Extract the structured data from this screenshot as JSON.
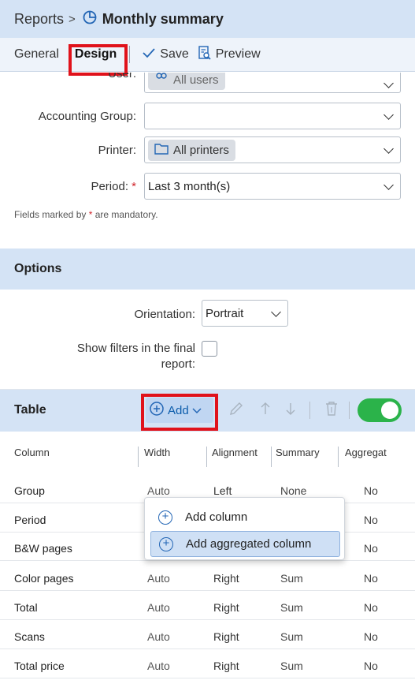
{
  "breadcrumb": {
    "parent": "Reports",
    "separator": ">",
    "title": "Monthly summary"
  },
  "tabs": {
    "general": "General",
    "design": "Design"
  },
  "toolbar": {
    "save": "Save",
    "preview": "Preview"
  },
  "filters": {
    "user_label": "User:",
    "user_value": "All users",
    "accounting_group_label": "Accounting Group:",
    "accounting_group_value": "",
    "printer_label": "Printer:",
    "printer_value": "All printers",
    "period_label": "Period:",
    "period_required": "*",
    "period_value": "Last 3 month(s)",
    "mandatory_note_prefix": "Fields marked by",
    "mandatory_note_star": "*",
    "mandatory_note_suffix": "are mandatory."
  },
  "options": {
    "header": "Options",
    "orientation_label": "Orientation:",
    "orientation_value": "Portrait",
    "show_filters_label_line1": "Show filters in the final",
    "show_filters_label_line2": "report:",
    "show_filters_checked": false
  },
  "table": {
    "header": "Table",
    "add_label": "Add",
    "toggle_on": true,
    "columns": [
      "Column",
      "Width",
      "Alignment",
      "Summary",
      "Aggregat"
    ],
    "rows": [
      {
        "column": "Group",
        "width": "Auto",
        "alignment": "Left",
        "summary": "None",
        "aggregated": "No"
      },
      {
        "column": "Period",
        "width": "",
        "alignment": "",
        "summary": "",
        "aggregated": "No"
      },
      {
        "column": "B&W pages",
        "width": "",
        "alignment": "",
        "summary": "",
        "aggregated": "No"
      },
      {
        "column": "Color pages",
        "width": "Auto",
        "alignment": "Right",
        "summary": "Sum",
        "aggregated": "No"
      },
      {
        "column": "Total",
        "width": "Auto",
        "alignment": "Right",
        "summary": "Sum",
        "aggregated": "No"
      },
      {
        "column": "Scans",
        "width": "Auto",
        "alignment": "Right",
        "summary": "Sum",
        "aggregated": "No"
      },
      {
        "column": "Total price",
        "width": "Auto",
        "alignment": "Right",
        "summary": "Sum",
        "aggregated": "No"
      }
    ]
  },
  "add_menu": {
    "items": [
      "Add column",
      "Add aggregated column"
    ]
  },
  "colors": {
    "header_bg": "#d4e3f5",
    "accent": "#2366b5",
    "toggle": "#2bb34a",
    "highlight_box": "#e0121b"
  }
}
